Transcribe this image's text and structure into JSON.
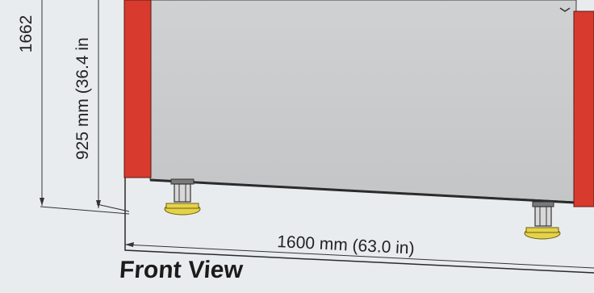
{
  "view_label": "Front View",
  "dimensions": {
    "height_outer": "1662",
    "height_inner": "925 mm (36.4 in",
    "width": "1600 mm (63.0 in)"
  },
  "colors": {
    "background": "#e9ecee",
    "panel": "#c7c9cb",
    "side_panel": "#d83a2e",
    "foot": "#e4d24a",
    "line": "#2a2a2a"
  }
}
